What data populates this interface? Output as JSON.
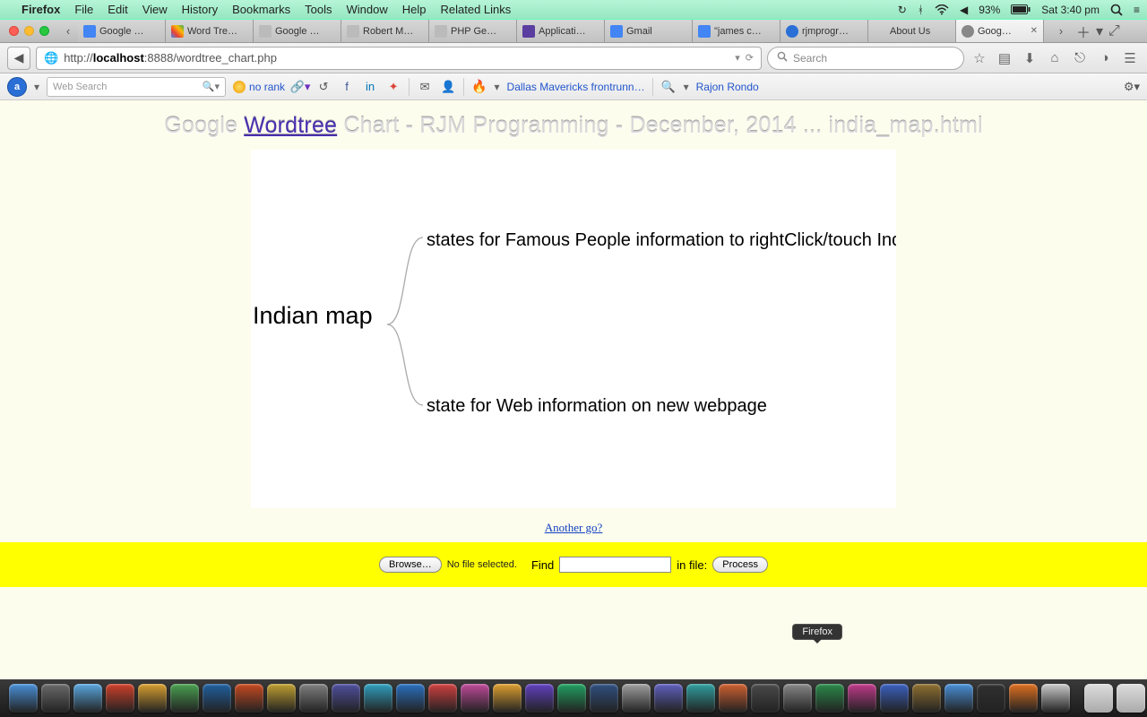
{
  "menubar": {
    "app": "Firefox",
    "items": [
      "File",
      "Edit",
      "View",
      "History",
      "Bookmarks",
      "Tools",
      "Window",
      "Help",
      "Related Links"
    ],
    "battery": "93%",
    "clock": "Sat 3:40 pm"
  },
  "tabs": [
    {
      "label": "Google …"
    },
    {
      "label": "Word Tre…"
    },
    {
      "label": "Google …"
    },
    {
      "label": "Robert M…"
    },
    {
      "label": "PHP Ge…"
    },
    {
      "label": "Applicati…"
    },
    {
      "label": "Gmail"
    },
    {
      "label": "\"james c…"
    },
    {
      "label": "rjmprogr…"
    },
    {
      "label": "About Us"
    },
    {
      "label": "Goog…",
      "active": true
    }
  ],
  "url": {
    "prefix": "http://",
    "host": "localhost",
    "port": ":8888",
    "path": "/wordtree_chart.php"
  },
  "searchPlaceholder": "Search",
  "toolbar2": {
    "webSearchPlaceholder": "Web Search",
    "norank": "no rank",
    "headline1": "Dallas Mavericks frontrunn…",
    "headline2": "Rajon Rondo"
  },
  "page": {
    "title_pre": "Google ",
    "title_link": "Wordtree",
    "title_post": " Chart - RJM Programming - December, 2014 ... india_map.html",
    "root": "Indian map",
    "branch1": "states for Famous People information to rightClick/touch Ind",
    "branch2": "state for Web information on new webpage",
    "another": "Another go?",
    "browse": "Browse…",
    "nofile": "No file selected.",
    "find": "Find",
    "infile": "in file:",
    "process": "Process"
  },
  "chart_data": {
    "type": "wordtree",
    "root": "Indian map",
    "children": [
      {
        "text": "states for Famous People information to rightClick/touch Ind"
      },
      {
        "text": "state for Web information on new webpage"
      }
    ]
  },
  "dock": {
    "tooltip": "Firefox",
    "left_count": 33,
    "right_count": 6
  }
}
